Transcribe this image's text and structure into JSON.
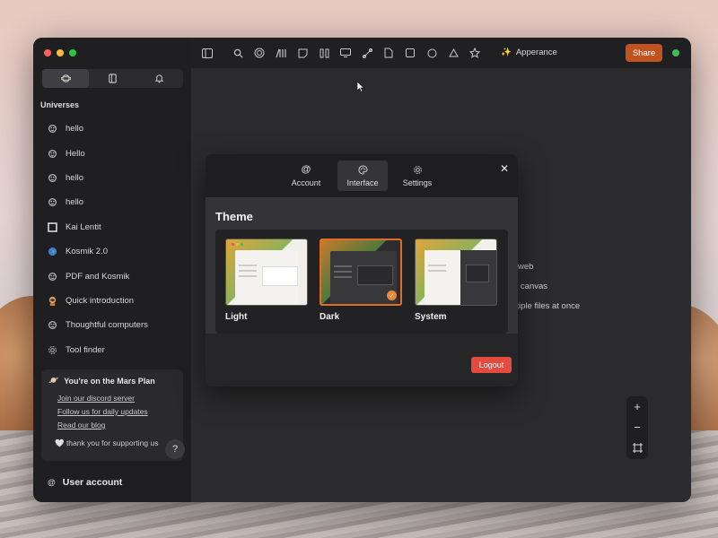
{
  "colors": {
    "accent": "#c1541e",
    "logout": "#e44b3f",
    "online": "#3bbd57",
    "selection": "#e06b2a"
  },
  "window": {
    "traffic_lights": [
      "#ff5f57",
      "#febc2e",
      "#28c840"
    ]
  },
  "sidebar": {
    "segments": [
      {
        "icon": "planet-icon",
        "label": "🪐"
      },
      {
        "icon": "book-icon",
        "label": "📖"
      },
      {
        "icon": "bell-icon",
        "label": "🔔"
      }
    ],
    "section_title": "Universes",
    "items": [
      {
        "icon": "planet-icon",
        "label": "hello"
      },
      {
        "icon": "planet-icon",
        "label": "Hello"
      },
      {
        "icon": "planet-icon",
        "label": "hello"
      },
      {
        "icon": "planet-icon",
        "label": "hello"
      },
      {
        "icon": "square-icon",
        "label": "Kai Lentit"
      },
      {
        "icon": "earth-icon",
        "label": "Kosmik 2.0"
      },
      {
        "icon": "planet-icon",
        "label": "PDF and Kosmik"
      },
      {
        "icon": "astronaut-icon",
        "label": "Quick introduction"
      },
      {
        "icon": "planet-icon",
        "label": "Thoughtful computers"
      },
      {
        "icon": "gear-icon",
        "label": "Tool finder"
      }
    ],
    "plan": {
      "title": "You're on the Mars Plan",
      "links": [
        "Join our discord server",
        "Follow us for daily updates",
        "Read our blog"
      ],
      "thanks": "🤍 thank you for supporting us"
    },
    "user": "User account"
  },
  "toolbar": {
    "appearance": "Apperance",
    "share": "Share"
  },
  "canvas": {
    "bg_lines": [
      "web",
      "e canvas",
      "ultiple files at once"
    ],
    "help": "?"
  },
  "modal": {
    "tabs": [
      {
        "icon": "at-icon",
        "label": "Account"
      },
      {
        "icon": "palette-icon",
        "label": "Interface"
      },
      {
        "icon": "gear-icon",
        "label": "Settings"
      }
    ],
    "active_tab": "Interface",
    "section_title": "Theme",
    "themes": [
      {
        "label": "Light"
      },
      {
        "label": "Dark",
        "selected": true
      },
      {
        "label": "System"
      }
    ],
    "logout": "Logout"
  }
}
